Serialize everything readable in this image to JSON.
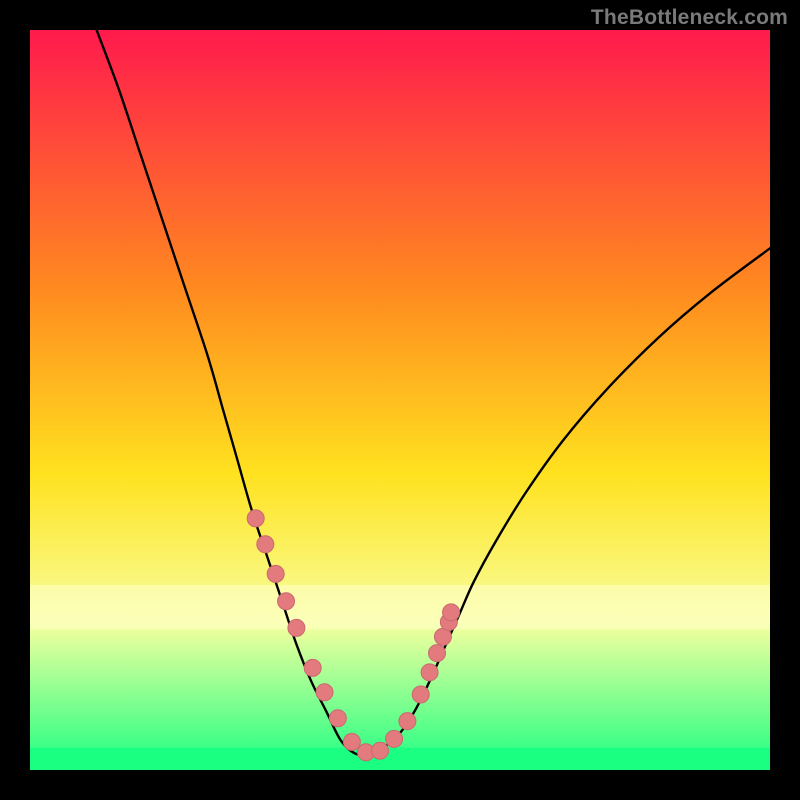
{
  "watermark": "TheBottleneck.com",
  "colors": {
    "page_bg": "#000000",
    "gradient_top": "#ff1a4d",
    "gradient_mid1": "#ff8a1f",
    "gradient_mid2": "#ffe21f",
    "gradient_mid3": "#f7ff9f",
    "gradient_bottom": "#1aff82",
    "curve": "#000000",
    "marker_fill": "#e27a7e",
    "marker_stroke": "#c96a6e",
    "band_pale": "#ffffcc",
    "band_green": "#1aff82"
  },
  "chart_data": {
    "type": "line",
    "title": "",
    "xlabel": "",
    "ylabel": "",
    "xlim": [
      0,
      100
    ],
    "ylim": [
      0,
      100
    ],
    "grid": false,
    "legend": null,
    "notes": "Bottleneck-style V curve. Y is implied mismatch % (0 at bottom = no bottleneck, 100 at top). X is implied relative GPU/CPU balance. Minimum around x≈44. Markers along lower portion of curve. Pale-yellow band ~y=19..25, green band ~y=0..3.",
    "series": [
      {
        "name": "curve",
        "x": [
          9,
          12,
          15,
          18,
          21,
          24,
          26,
          28,
          30,
          32,
          34,
          36,
          38,
          40,
          42,
          44,
          46,
          48,
          50,
          52,
          54,
          56,
          58,
          60,
          63,
          67,
          72,
          78,
          85,
          92,
          100
        ],
        "y": [
          100,
          92,
          83,
          74,
          65,
          56,
          49,
          42,
          35,
          29,
          23,
          17,
          12,
          8,
          4,
          2.2,
          2.2,
          3.2,
          5,
          8,
          12,
          16.5,
          21,
          25.5,
          31,
          37.5,
          44.5,
          51.5,
          58.5,
          64.5,
          70.5
        ]
      }
    ],
    "markers": {
      "name": "highlighted-points",
      "x": [
        30.5,
        31.8,
        33.2,
        34.6,
        36.0,
        38.2,
        39.8,
        41.6,
        43.5,
        45.4,
        47.3,
        49.2,
        51.0,
        52.8,
        54.0,
        55.0,
        55.8,
        56.6,
        56.9
      ],
      "y": [
        34.0,
        30.5,
        26.5,
        22.8,
        19.2,
        13.8,
        10.5,
        7.0,
        3.8,
        2.4,
        2.6,
        4.2,
        6.6,
        10.2,
        13.2,
        15.8,
        18.0,
        20.0,
        21.3
      ]
    },
    "bands": [
      {
        "name": "pale-yellow-band",
        "y0": 19,
        "y1": 25,
        "color": "#ffffcc"
      },
      {
        "name": "green-band",
        "y0": 0,
        "y1": 3,
        "color": "#1aff82"
      }
    ]
  }
}
